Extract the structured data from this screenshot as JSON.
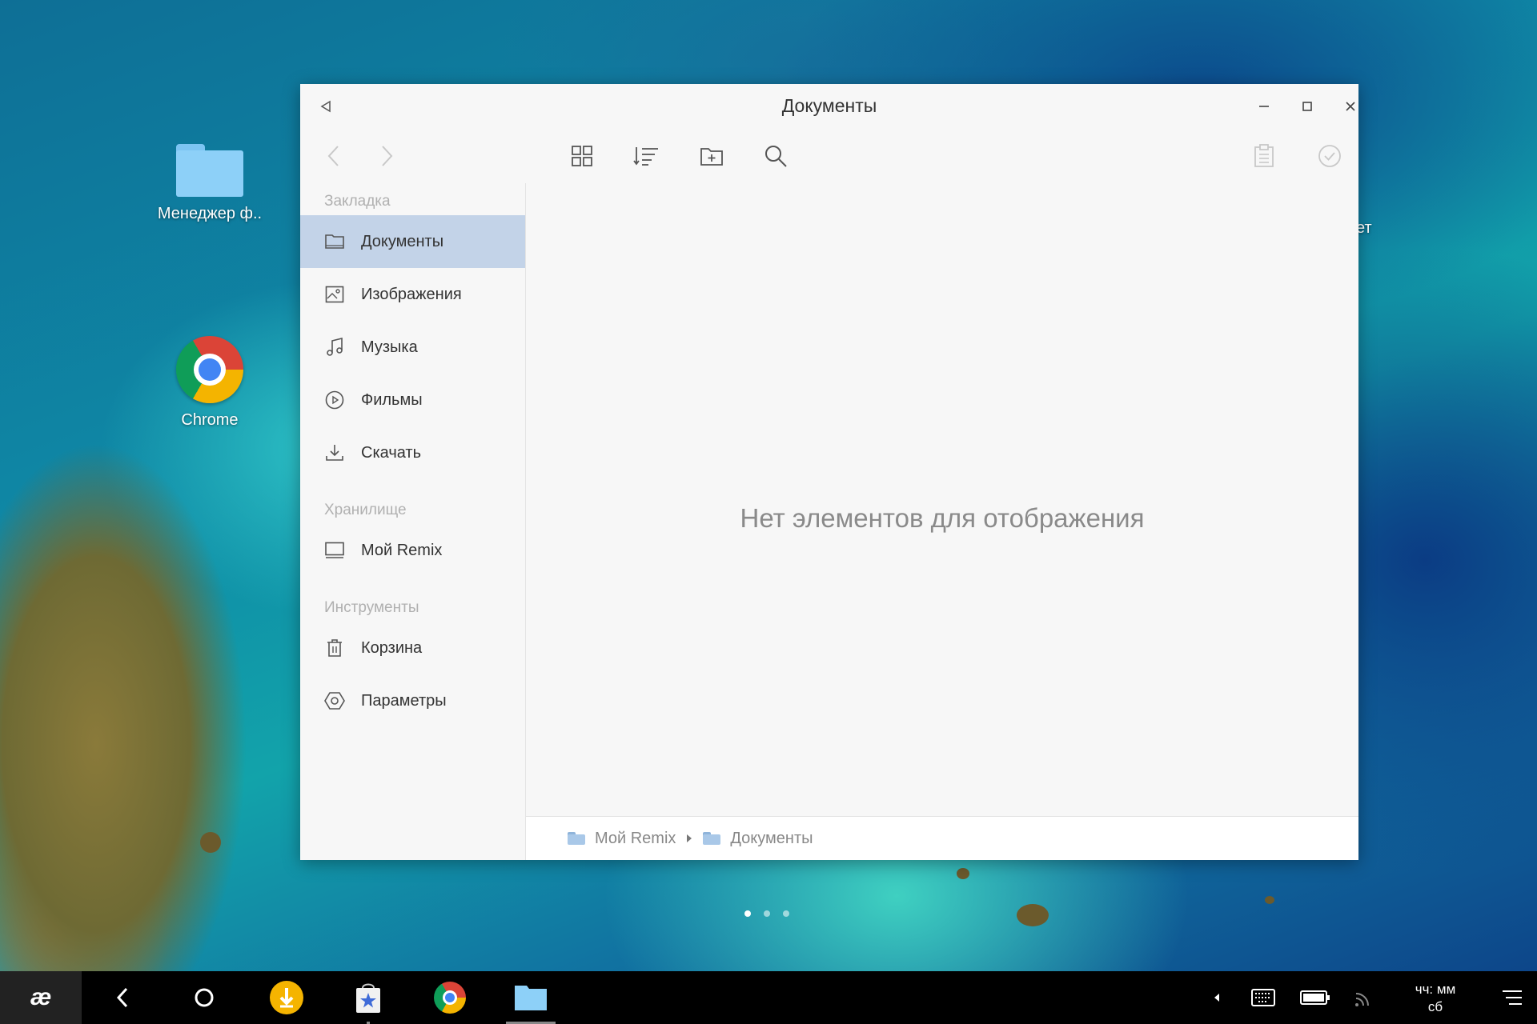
{
  "desktop": {
    "icons": [
      {
        "label": "Менеджер ф..",
        "icon": "folder-icon"
      },
      {
        "label": "Chrome",
        "icon": "chrome-icon"
      }
    ],
    "partial_label": "ет",
    "page_dots": 3
  },
  "window": {
    "title": "Документы",
    "controls": [
      "minimize-icon",
      "maximize-icon",
      "close-icon"
    ],
    "toolbar": {
      "icons": [
        "back-icon",
        "forward-icon",
        "grid-view-icon",
        "sort-icon",
        "new-folder-icon",
        "search-icon",
        "clipboard-icon",
        "select-all-icon"
      ]
    },
    "sidebar": {
      "bookmarks_header": "Закладка",
      "bookmarks": [
        {
          "label": "Документы",
          "icon": "folder-icon",
          "active": true
        },
        {
          "label": "Изображения",
          "icon": "image-icon"
        },
        {
          "label": "Музыка",
          "icon": "music-icon"
        },
        {
          "label": "Фильмы",
          "icon": "play-icon"
        },
        {
          "label": "Скачать",
          "icon": "download-icon"
        }
      ],
      "storage_header": "Хранилище",
      "storage": [
        {
          "label": "Мой Remix",
          "icon": "monitor-icon"
        }
      ],
      "tools_header": "Инструменты",
      "tools": [
        {
          "label": "Корзина",
          "icon": "trash-icon"
        },
        {
          "label": "Параметры",
          "icon": "settings-icon"
        }
      ]
    },
    "empty_message": "Нет элементов для отображения",
    "breadcrumb": [
      "Мой Remix",
      "Документы"
    ]
  },
  "taskbar": {
    "clock_time": "чч: мм",
    "clock_day": "сб",
    "apps": [
      "remix-logo-icon",
      "back-icon",
      "home-icon",
      "download-app-icon",
      "store-icon",
      "chrome-icon",
      "file-manager-icon"
    ],
    "tray": [
      "tray-expand-icon",
      "keyboard-icon",
      "battery-icon",
      "wifi-icon",
      "notifications-icon"
    ]
  },
  "colors": {
    "sidebar_active": "#c3d3e8",
    "window_bg": "#f7f7f7",
    "taskbar_bg": "#000000"
  }
}
